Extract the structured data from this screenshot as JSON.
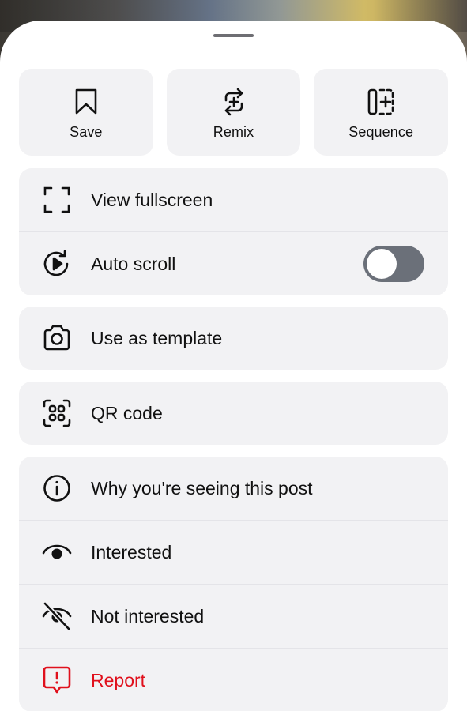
{
  "sheet": {
    "quick_actions": [
      {
        "label": "Save",
        "icon": "bookmark-icon"
      },
      {
        "label": "Remix",
        "icon": "remix-icon"
      },
      {
        "label": "Sequence",
        "icon": "sequence-icon"
      }
    ],
    "group1": {
      "view_fullscreen": {
        "label": "View fullscreen",
        "icon": "fullscreen-icon"
      },
      "auto_scroll": {
        "label": "Auto scroll",
        "icon": "auto-scroll-icon",
        "enabled": false
      }
    },
    "group2": {
      "use_as_template": {
        "label": "Use as template",
        "icon": "camera-icon"
      }
    },
    "group3": {
      "qr_code": {
        "label": "QR code",
        "icon": "qr-code-icon"
      }
    },
    "group4": {
      "why_seeing": {
        "label": "Why you're seeing this post",
        "icon": "info-icon"
      },
      "interested": {
        "label": "Interested",
        "icon": "eye-icon"
      },
      "not_interested": {
        "label": "Not interested",
        "icon": "eye-slash-icon"
      },
      "report": {
        "label": "Report",
        "icon": "report-icon",
        "color": "#e0101c"
      }
    }
  }
}
